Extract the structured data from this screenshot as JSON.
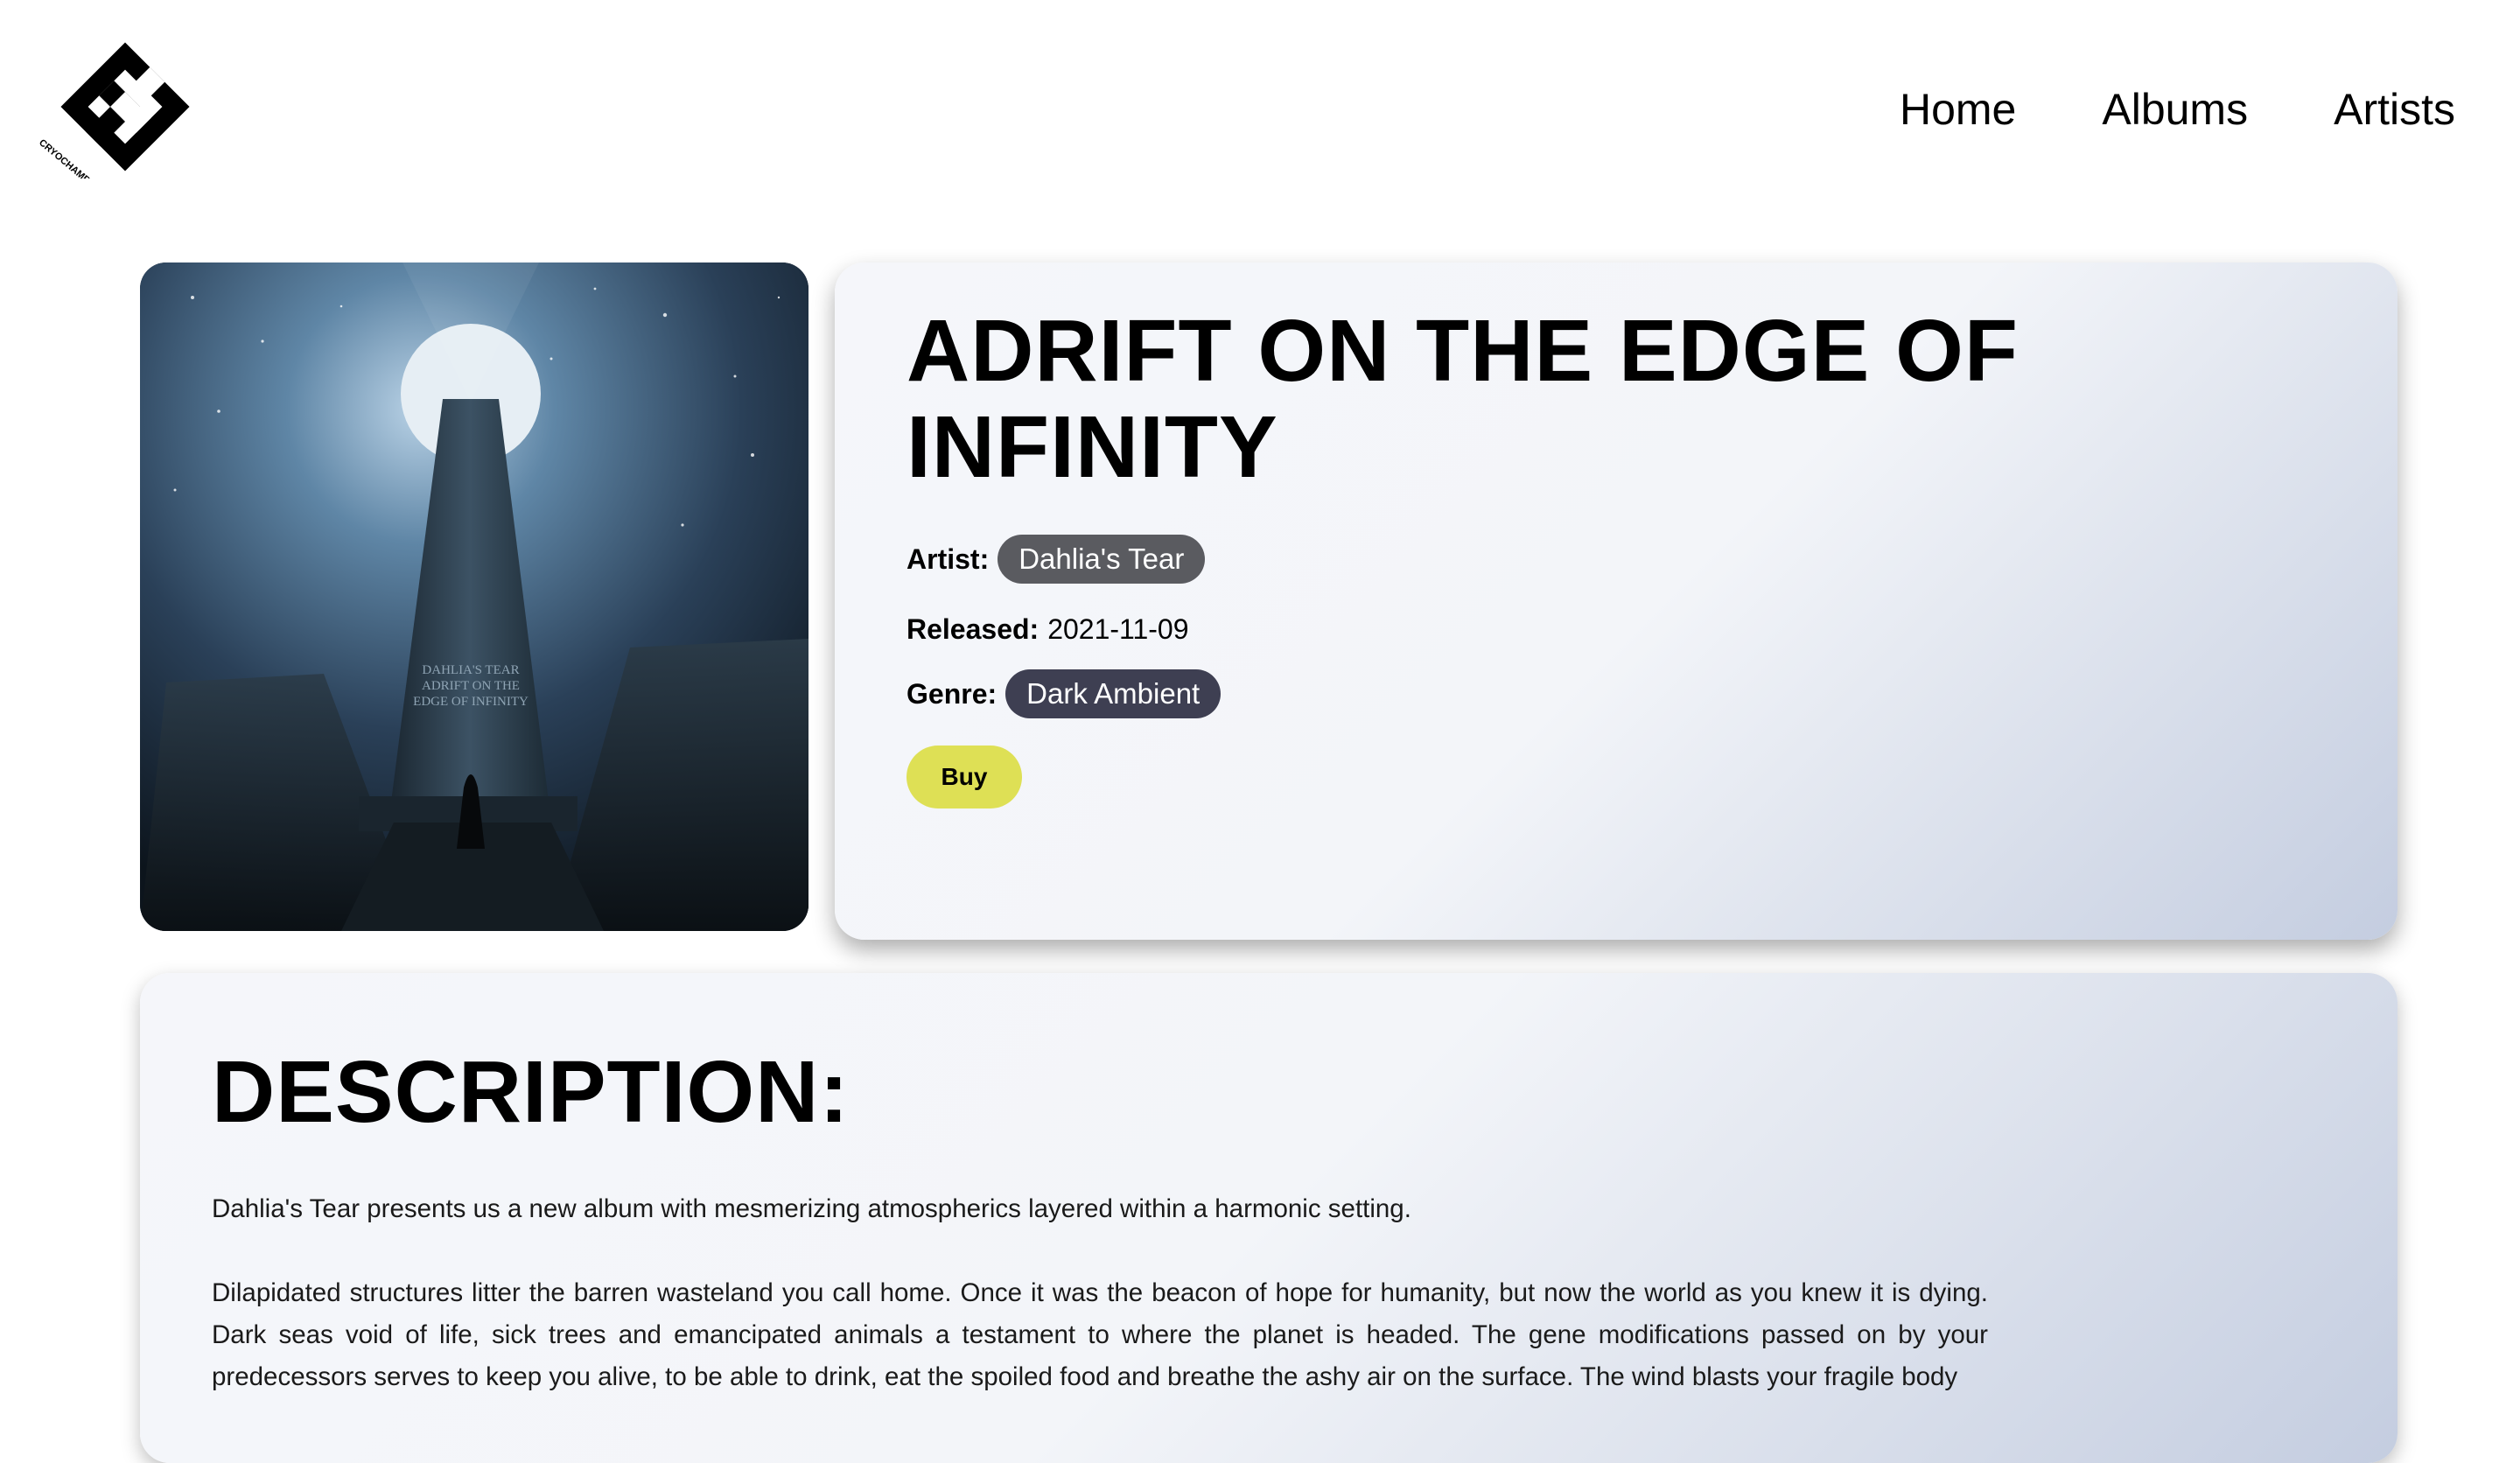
{
  "header": {
    "logo_text": "CRYOCHAMBER",
    "nav": [
      {
        "label": "Home"
      },
      {
        "label": "Albums"
      },
      {
        "label": "Artists"
      }
    ]
  },
  "album": {
    "title": "ADRIFT ON THE EDGE OF INFINITY",
    "cover_text": [
      "DAHLIA'S TEAR",
      "ADRIFT ON THE",
      "EDGE OF INFINITY"
    ],
    "artist_label": "Artist:",
    "artist": "Dahlia's Tear",
    "released_label": "Released:",
    "released": "2021-11-09",
    "genre_label": "Genre:",
    "genre": "Dark Ambient",
    "buy_label": "Buy"
  },
  "description": {
    "heading": "DESCRIPTION:",
    "paragraphs": [
      "Dahlia's Tear presents us a new album with mesmerizing atmospherics layered within a harmonic setting.",
      "Dilapidated structures litter the barren wasteland you call home. Once it was the beacon of hope for humanity, but now the world as you knew it is dying. Dark seas void of life, sick trees and emancipated animals a testament to where the planet is headed. The gene modifications passed on by your predecessors serves to keep you alive, to be able to drink, eat the spoiled food and breathe the ashy air on the surface. The wind blasts your fragile body"
    ]
  },
  "colors": {
    "buy": "#dee055",
    "artist_pill": "#5a5b60",
    "genre_pill": "#3e3f52"
  }
}
